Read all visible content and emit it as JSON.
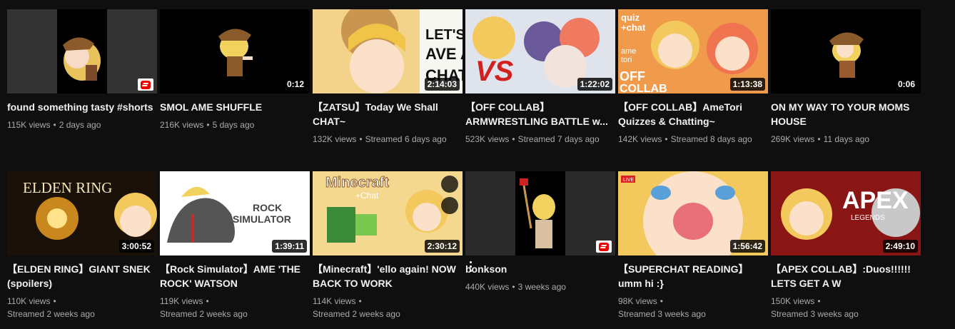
{
  "videos": [
    {
      "title": "found something tasty #shorts",
      "views": "115K views",
      "age": "2 days ago",
      "duration": "",
      "shorts": true
    },
    {
      "title": "SMOL AME SHUFFLE",
      "views": "216K views",
      "age": "5 days ago",
      "duration": "0:12",
      "shorts": false
    },
    {
      "title": "【ZATSU】Today We Shall CHAT~",
      "views": "132K views",
      "age": "Streamed 6 days ago",
      "duration": "2:14:03",
      "shorts": false
    },
    {
      "title": "【OFF COLLAB】 ARMWRESTLING BATTLE w...",
      "views": "523K views",
      "age": "Streamed 7 days ago",
      "duration": "1:22:02",
      "shorts": false
    },
    {
      "title": "【OFF COLLAB】AmeTori Quizzes & Chatting~",
      "views": "142K views",
      "age": "Streamed 8 days ago",
      "duration": "1:13:38",
      "shorts": false
    },
    {
      "title": "ON MY WAY TO YOUR MOMS HOUSE",
      "views": "269K views",
      "age": "11 days ago",
      "duration": "0:06",
      "shorts": false
    },
    {
      "title": "【ELDEN RING】GIANT SNEK (spoilers)",
      "views": "110K views",
      "age": "Streamed 2 weeks ago",
      "duration": "3:00:52",
      "shorts": false
    },
    {
      "title": "【Rock Simulator】AME 'THE ROCK' WATSON",
      "views": "119K views",
      "age": "Streamed 2 weeks ago",
      "duration": "1:39:11",
      "shorts": false
    },
    {
      "title": "【Minecraft】'ello again! NOW BACK TO WORK",
      "views": "114K views",
      "age": "Streamed 2 weeks ago",
      "duration": "2:30:12",
      "shorts": false
    },
    {
      "title": "bonkson",
      "views": "440K views",
      "age": "3 weeks ago",
      "duration": "",
      "shorts": true
    },
    {
      "title": "【SUPERCHAT READING】 umm hi :}",
      "views": "98K views",
      "age": "Streamed 3 weeks ago",
      "duration": "1:56:42",
      "shorts": false
    },
    {
      "title": "【APEX COLLAB】:Duos!!!!!! LETS GET A W",
      "views": "150K views",
      "age": "Streamed 3 weeks ago",
      "duration": "2:49:10",
      "shorts": false
    }
  ],
  "thumb_text": {
    "zatsu": "LET'S HAVE A CHAT",
    "vs": "VS",
    "quiz": "quiz + chat",
    "ametori": "ame tori",
    "offcollab": "OFF COLLAB",
    "elden": "ELDEN RING",
    "rock": "ROCK SIMULATOR",
    "minecraft": "Minecraft + Chat",
    "live": "LIVE",
    "apex": "APEX",
    "legends": "LEGENDS"
  },
  "sep": "•"
}
